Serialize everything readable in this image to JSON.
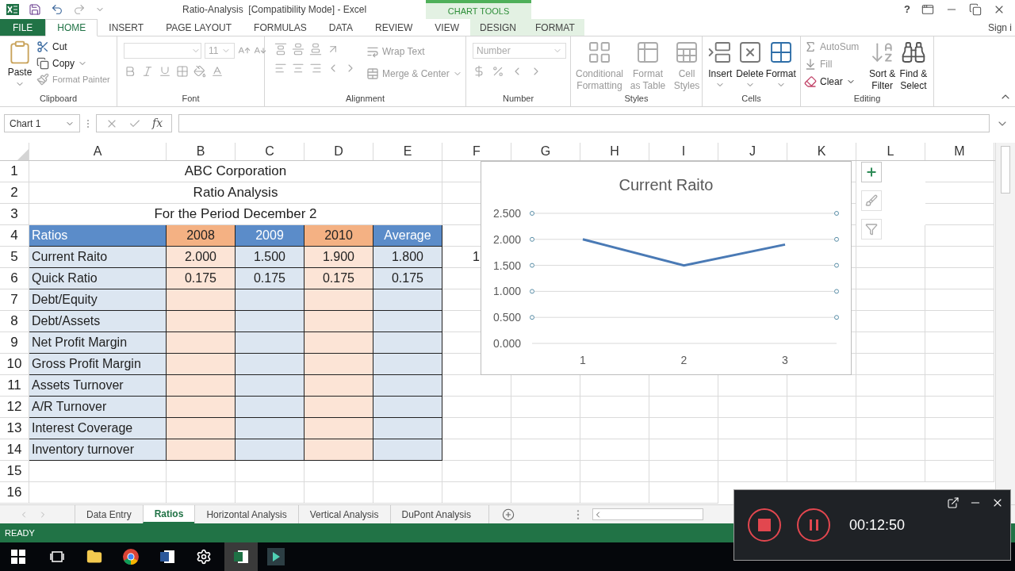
{
  "window": {
    "title": "Ratio-Analysis  [Compatibility Mode] - Excel",
    "contextual_group": "CHART TOOLS",
    "help": "?",
    "sign_in": "Sign i"
  },
  "ribbon_tabs": [
    {
      "label": "FILE",
      "kind": "file",
      "selected": false
    },
    {
      "label": "HOME",
      "kind": "normal",
      "selected": true
    },
    {
      "label": "INSERT",
      "kind": "normal",
      "selected": false
    },
    {
      "label": "PAGE LAYOUT",
      "kind": "normal",
      "selected": false
    },
    {
      "label": "FORMULAS",
      "kind": "normal",
      "selected": false
    },
    {
      "label": "DATA",
      "kind": "normal",
      "selected": false
    },
    {
      "label": "REVIEW",
      "kind": "normal",
      "selected": false
    },
    {
      "label": "VIEW",
      "kind": "normal",
      "selected": false
    },
    {
      "label": "DESIGN",
      "kind": "contextual",
      "selected": false
    },
    {
      "label": "FORMAT",
      "kind": "contextual",
      "selected": false
    }
  ],
  "ribbon": {
    "clipboard": {
      "label": "Clipboard",
      "paste": "Paste",
      "cut": "Cut",
      "copy": "Copy",
      "format_painter": "Format Painter"
    },
    "font": {
      "label": "Font",
      "size": "11"
    },
    "alignment": {
      "label": "Alignment",
      "wrap_text": "Wrap Text",
      "merge_center": "Merge & Center"
    },
    "number": {
      "label": "Number",
      "format": "Number"
    },
    "styles": {
      "label": "Styles",
      "conditional_formatting": "Conditional Formatting",
      "format_as_table": "Format as Table",
      "cell_styles": "Cell Styles"
    },
    "cells": {
      "label": "Cells",
      "insert": "Insert",
      "delete": "Delete",
      "format": "Format"
    },
    "editing": {
      "label": "Editing",
      "autosum": "AutoSum",
      "fill": "Fill",
      "clear": "Clear",
      "sort_filter": "Sort & Filter",
      "find_select": "Find & Select"
    }
  },
  "formula_bar": {
    "name_box": "Chart 1",
    "function_label": "fx"
  },
  "columns": [
    "A",
    "B",
    "C",
    "D",
    "E",
    "F",
    "G",
    "H",
    "I",
    "J",
    "K",
    "L",
    "M"
  ],
  "row_numbers": [
    "1",
    "2",
    "3",
    "4",
    "5",
    "6",
    "7",
    "8",
    "9",
    "10",
    "11",
    "12",
    "13",
    "14",
    "15",
    "16"
  ],
  "sheet": {
    "title_lines": [
      "ABC Corporation",
      "Ratio Analysis",
      "For the Period December 2"
    ],
    "header": [
      "Ratios",
      "2008",
      "2009",
      "2010",
      "Average"
    ],
    "rows": [
      {
        "label": "Current Raito",
        "values": [
          "2.000",
          "1.500",
          "1.900",
          "1.800"
        ],
        "column_f": "1"
      },
      {
        "label": "Quick Ratio",
        "values": [
          "0.175",
          "0.175",
          "0.175",
          "0.175"
        ]
      },
      {
        "label": "Debt/Equity"
      },
      {
        "label": "Debt/Assets"
      },
      {
        "label": "Net Profit Margin"
      },
      {
        "label": "Gross Profit Margin"
      },
      {
        "label": "Assets Turnover"
      },
      {
        "label": "A/R Turnover"
      },
      {
        "label": "Interest Coverage"
      },
      {
        "label": "Inventory turnover"
      }
    ]
  },
  "chart": {
    "selected": true,
    "chart_data": {
      "type": "line",
      "title": "Current Raito",
      "grid": true,
      "categories": [
        "1",
        "2",
        "3"
      ],
      "series": [
        {
          "color": "#4a7ab5",
          "values": [
            2.0,
            1.5,
            1.9
          ]
        }
      ],
      "ylim": [
        0,
        2.5
      ],
      "yticks": [
        {
          "value": 0,
          "label": "0.000"
        },
        {
          "value": 0.5,
          "label": "0.500"
        },
        {
          "value": 1,
          "label": "1.000"
        },
        {
          "value": 1.5,
          "label": "1.500"
        },
        {
          "value": 2,
          "label": "2.000"
        },
        {
          "value": 2.5,
          "label": "2.500"
        }
      ]
    }
  },
  "sheet_tabs": [
    {
      "label": "Data Entry",
      "selected": false
    },
    {
      "label": "Ratios",
      "selected": true
    },
    {
      "label": "Horizontal Analysis",
      "selected": false
    },
    {
      "label": "Vertical Analysis",
      "selected": false
    },
    {
      "label": "DuPont Analysis",
      "selected": false
    }
  ],
  "status_bar": {
    "text": "READY"
  },
  "recorder": {
    "time": "00:12:50"
  }
}
